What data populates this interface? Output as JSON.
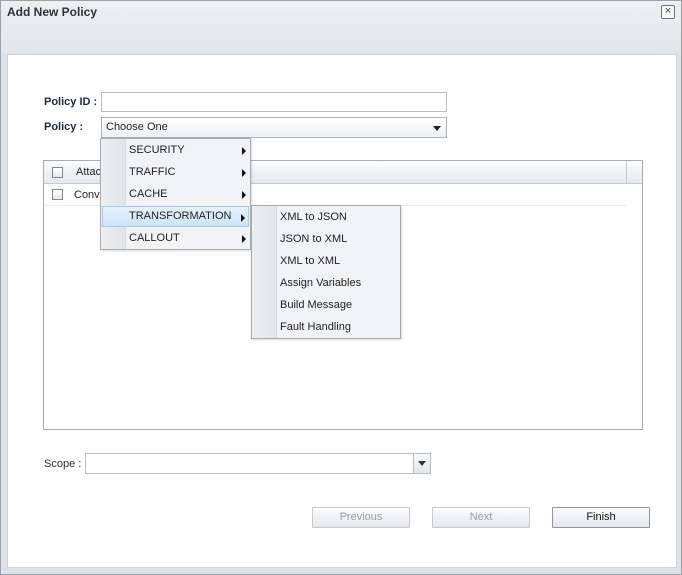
{
  "dialog": {
    "title": "Add New Policy",
    "close_glyph": "×"
  },
  "form": {
    "policy_id_label": "Policy ID :",
    "policy_id_value": "",
    "policy_label": "Policy :",
    "policy_selected": "Choose One",
    "scope_label": "Scope :",
    "scope_value": ""
  },
  "grid": {
    "header_label": "Attac",
    "rows": [
      {
        "label": "Conve"
      }
    ]
  },
  "policy_menu": {
    "items": [
      {
        "label": "SECURITY"
      },
      {
        "label": "TRAFFIC"
      },
      {
        "label": "CACHE"
      },
      {
        "label": "TRANSFORMATION"
      },
      {
        "label": "CALLOUT"
      }
    ],
    "active_index": 3
  },
  "transformation_submenu": {
    "items": [
      {
        "label": "XML to JSON"
      },
      {
        "label": "JSON to XML"
      },
      {
        "label": "XML to XML"
      },
      {
        "label": "Assign Variables"
      },
      {
        "label": "Build Message"
      },
      {
        "label": "Fault Handling"
      }
    ]
  },
  "buttons": {
    "previous": "Previous",
    "next": "Next",
    "finish": "Finish"
  },
  "colors": {
    "menu_highlight": "#cfe3f8",
    "disabled_text": "#9aa0a6"
  }
}
